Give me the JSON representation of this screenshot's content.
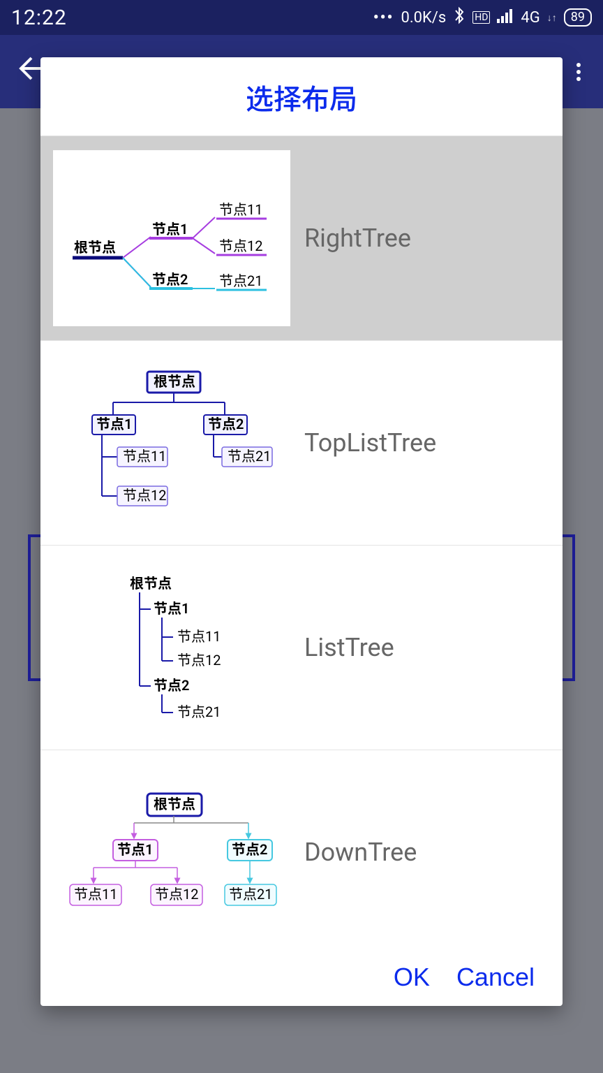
{
  "status": {
    "time": "12:22",
    "netspeed": "0.0K/s",
    "network": "4G",
    "hd": "HD",
    "battery": "89"
  },
  "dialog": {
    "title": "选择布局",
    "ok": "OK",
    "cancel": "Cancel"
  },
  "options": [
    {
      "label": "RightTree"
    },
    {
      "label": "TopListTree"
    },
    {
      "label": "ListTree"
    },
    {
      "label": "DownTree"
    }
  ],
  "nodes": {
    "root": "根节点",
    "n1": "节点1",
    "n2": "节点2",
    "n11": "节点11",
    "n12": "节点12",
    "n21": "节点21"
  }
}
